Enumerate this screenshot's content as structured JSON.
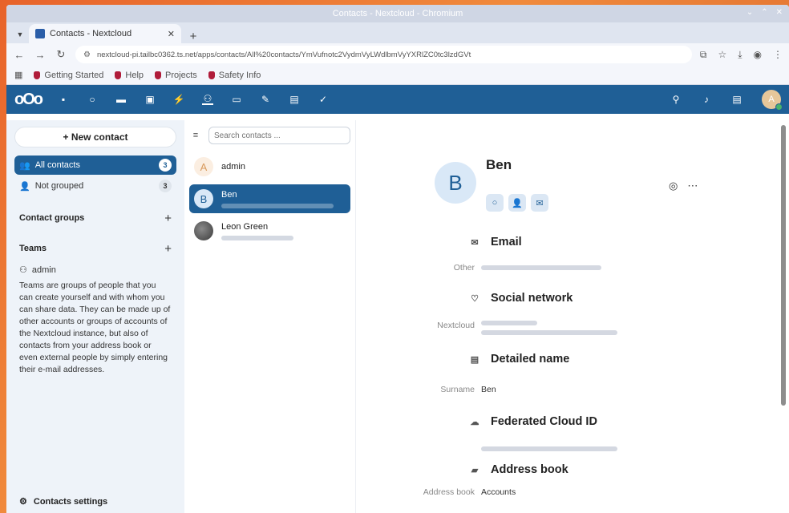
{
  "browser": {
    "window_title": "Contacts - Nextcloud - Chromium",
    "tab_title": "Contacts - Nextcloud",
    "url": "nextcloud-pi.tailbc0362.ts.net/apps/contacts/All%20contacts/YmVufnotc2VydmVyLWdlbmVyYXRlZC0tc3lzdGVt",
    "bookmarks": [
      "Getting Started",
      "Help",
      "Projects",
      "Safety Info"
    ]
  },
  "nc": {
    "avatar_letter": "A"
  },
  "sidebar": {
    "new_contact": "+ New contact",
    "all_contacts": "All contacts",
    "all_count": "3",
    "not_grouped": "Not grouped",
    "not_grouped_count": "3",
    "contact_groups": "Contact groups",
    "teams": "Teams",
    "team_admin": "admin",
    "teams_desc": "Teams are groups of people that you can create yourself and with whom you can share data. They can be made up of other accounts or groups of accounts of the Nextcloud instance, but also of contacts from your address book or even external people by simply entering their e-mail addresses.",
    "settings": "Contacts settings"
  },
  "list": {
    "search_placeholder": "Search contacts ...",
    "contacts": [
      {
        "letter": "A",
        "name": "admin"
      },
      {
        "letter": "B",
        "name": "Ben"
      },
      {
        "letter": "",
        "name": "Leon Green"
      }
    ]
  },
  "detail": {
    "avatar_letter": "B",
    "name": "Ben",
    "email_header": "Email",
    "email_label": "Other",
    "social_header": "Social network",
    "social_label": "Nextcloud",
    "detailed_header": "Detailed name",
    "surname_label": "Surname",
    "surname_value": "Ben",
    "fed_header": "Federated Cloud ID",
    "ab_header": "Address book",
    "ab_label": "Address book",
    "ab_value": "Accounts"
  }
}
